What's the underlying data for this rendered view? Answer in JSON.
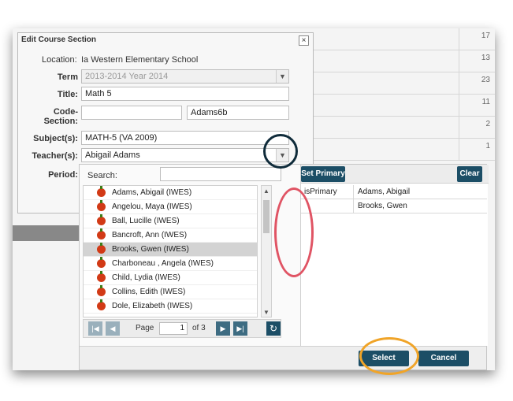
{
  "background": {
    "row_numbers": [
      "17",
      "13",
      "23",
      "11",
      "2",
      "1"
    ]
  },
  "dialog": {
    "title": "Edit Course Section",
    "location_label": "Location:",
    "location_value": "Ia Western Elementary School",
    "term_label": "Term",
    "term_value": "2013-2014 Year 2014",
    "title_label": "Title:",
    "title_value": "Math 5",
    "code_label": "Code-\nSection:",
    "code_value": "",
    "section_value": "Adams6b",
    "subject_label": "Subject(s):",
    "subject_value": "MATH-5 (VA 2009)",
    "teacher_label": "Teacher(s):",
    "teacher_value": "Abigail Adams",
    "period_label": "Period:",
    "close_glyph": "×"
  },
  "picker": {
    "search_label": "Search:",
    "search_value": "",
    "teachers": [
      "Adams, Abigail (IWES)",
      "Angelou, Maya (IWES)",
      "Ball, Lucille (IWES)",
      "Bancroft, Ann (IWES)",
      "Brooks, Gwen (IWES)",
      "Charboneau , Angela (IWES)",
      "Child, Lydia (IWES)",
      "Collins, Edith (IWES)",
      "Dole, Elizabeth (IWES)"
    ],
    "selected_index": 4,
    "pager": {
      "page_label": "Page",
      "page": "1",
      "of_label": "of 3"
    },
    "set_primary": "Set Primary",
    "clear": "Clear",
    "selected": [
      {
        "role": "isPrimary",
        "name": "Adams, Abigail"
      },
      {
        "role": "",
        "name": "Brooks, Gwen"
      }
    ],
    "select_btn": "Select",
    "cancel_btn": "Cancel"
  },
  "colors": {
    "accent": "#1c4e66",
    "ring_navy": "#0f2b3a",
    "ring_red": "#e05464",
    "ring_orange": "#f0a428"
  }
}
